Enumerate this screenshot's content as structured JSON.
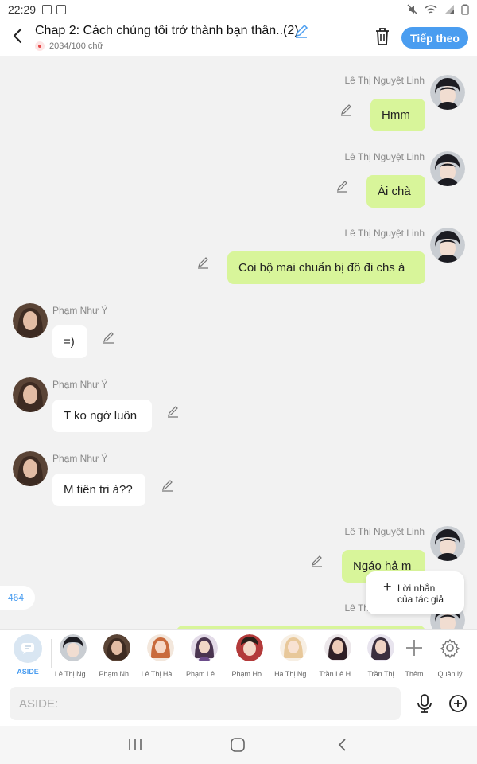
{
  "status_bar": {
    "time": "22:29"
  },
  "header": {
    "title": "Chap 2: Cách chúng tôi trở thành bạn thân..(2)",
    "word_count": "2034/100 chữ",
    "next_label": "Tiếp theo",
    "accent_color": "#4a9df0"
  },
  "messages": [
    {
      "side": "right",
      "name": "Lê Thị Nguyệt Linh",
      "text": "Hmm"
    },
    {
      "side": "right",
      "name": "Lê Thị Nguyệt Linh",
      "text": "Ái chà"
    },
    {
      "side": "right",
      "name": "Lê Thị Nguyệt Linh",
      "text": "Coi bộ mai chuẩn bị đồ đi chs à"
    },
    {
      "side": "left",
      "name": "Phạm Như Ý",
      "text": "=)"
    },
    {
      "side": "left",
      "name": "Phạm Như Ý",
      "text": "T ko ngờ luôn"
    },
    {
      "side": "left",
      "name": "Phạm Như Ý",
      "text": "M tiên tri à??"
    },
    {
      "side": "right",
      "name": "Lê Thị Nguyệt Linh",
      "text": "Ngáo hả m"
    },
    {
      "side": "right",
      "name": "Lê Thị Nguyệt Linh",
      "text": ""
    }
  ],
  "message_count": "464",
  "author_note": {
    "line1": "Lời nhắn",
    "line2": "của tác giả"
  },
  "characters": [
    {
      "label": "ASIDE"
    },
    {
      "label": "Lê Thị Ng..."
    },
    {
      "label": "Phạm Nh..."
    },
    {
      "label": "Lê Thị Hà ..."
    },
    {
      "label": "Phạm Lê ..."
    },
    {
      "label": "Phạm Ho..."
    },
    {
      "label": "Hà Thị Ng..."
    },
    {
      "label": "Trần Lê H..."
    },
    {
      "label": "Trần Thị"
    },
    {
      "label": "Thêm"
    },
    {
      "label": "Quản lý"
    }
  ],
  "input": {
    "placeholder": "ASIDE:"
  },
  "colors": {
    "right_bubble": "#d8f59a",
    "left_bubble": "#ffffff",
    "background": "#f2f2f2"
  }
}
